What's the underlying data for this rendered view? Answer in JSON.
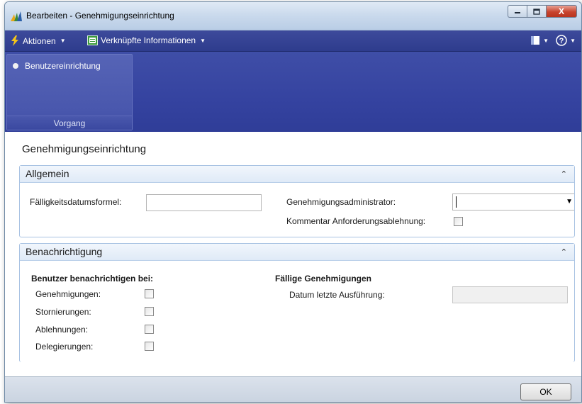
{
  "window": {
    "title": "Bearbeiten - Genehmigungseinrichtung",
    "close_glyph": "X"
  },
  "menubar": {
    "actions_label": "Aktionen",
    "related_label": "Verknüpfte Informationen"
  },
  "ribbon": {
    "button_label": "Benutzereinrichtung",
    "group_label": "Vorgang"
  },
  "page_title": "Genehmigungseinrichtung",
  "general": {
    "header": "Allgemein",
    "due_date_formula_label": "Fälligkeitsdatumsformel:",
    "due_date_formula_value": "",
    "approval_admin_label": "Genehmigungsadministrator:",
    "approval_admin_value": "",
    "comment_rejection_label": "Kommentar Anforderungsablehnung:"
  },
  "notification": {
    "header": "Benachrichtigung",
    "notify_group_title": "Benutzer benachrichtigen bei:",
    "approvals_label": "Genehmigungen:",
    "cancellations_label": "Stornierungen:",
    "rejections_label": "Ablehnungen:",
    "delegations_label": "Delegierungen:",
    "due_group_title": "Fällige Genehmigungen",
    "last_run_label": "Datum letzte Ausführung:",
    "last_run_value": ""
  },
  "footer": {
    "ok_label": "OK"
  },
  "colors": {
    "action_bar": "#2e3c8d",
    "ribbon": "#3543a0",
    "section_border": "#a9c3e3",
    "close_button": "#c8442e"
  }
}
